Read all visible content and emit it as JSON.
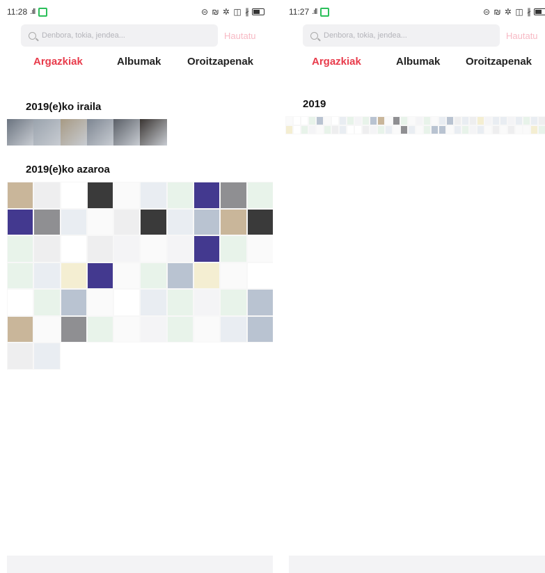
{
  "left": {
    "status": {
      "time": "11:28",
      "signal": ".ıll",
      "right_icons": "⊝ ₪ ✲ ◫ ∦"
    },
    "search": {
      "placeholder": "Denbora, tokia, jendea...",
      "select_label": "Hautatu"
    },
    "tabs": [
      {
        "label": "Argazkiak",
        "active": true
      },
      {
        "label": "Albumak",
        "active": false
      },
      {
        "label": "Oroitzapenak",
        "active": false
      }
    ],
    "sections": [
      {
        "title": "2019(e)ko iraila",
        "count": 6
      },
      {
        "title": "2019(e)ko azaroa",
        "count": 62
      }
    ]
  },
  "right": {
    "status": {
      "time": "11:27",
      "signal": ".ıll",
      "right_icons": "⊝ ₪ ✲ ◫ ∦"
    },
    "search": {
      "placeholder": "Denbora, tokia, jendea...",
      "select_label": "Hautatu"
    },
    "tabs": [
      {
        "label": "Argazkiak",
        "active": true
      },
      {
        "label": "Albumak",
        "active": false
      },
      {
        "label": "Oroitzapenak",
        "active": false
      }
    ],
    "sections": [
      {
        "title": "2019",
        "count": 68
      }
    ]
  },
  "colors": {
    "accent": "#e83b4b",
    "select_disabled": "#f7b9c4",
    "search_bg": "#f1f1f3"
  }
}
